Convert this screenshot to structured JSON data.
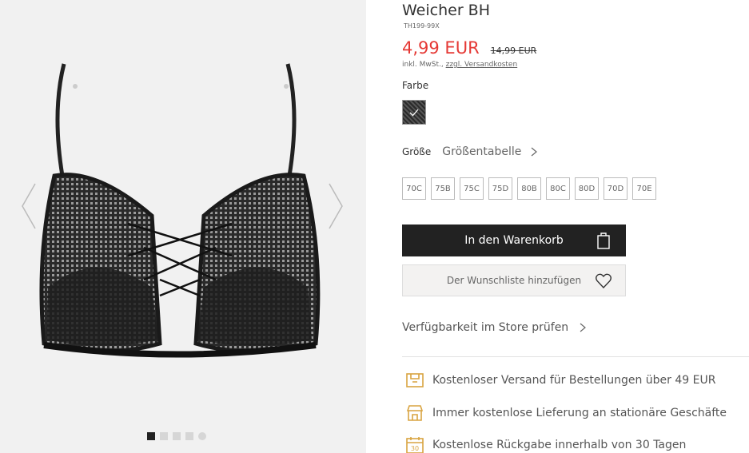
{
  "product": {
    "title": "Weicher BH",
    "sku": "TH199-99X",
    "price": "4,99 EUR",
    "old_price": "14,99 EUR",
    "tax_prefix": "inkl. MwSt.,",
    "tax_link": "zzgl. Versandkosten"
  },
  "colors": {
    "label": "Farbe",
    "selected": "Schwarz"
  },
  "sizes": {
    "label": "Größe",
    "table_link": "Größentabelle",
    "options": [
      "70C",
      "75B",
      "75C",
      "75D",
      "80B",
      "80C",
      "80D",
      "70D",
      "70E"
    ]
  },
  "actions": {
    "cart_label": "In den Warenkorb",
    "wishlist_label": "Der Wunschliste hinzufügen",
    "store_check": "Verfügbarkeit im Store prüfen"
  },
  "benefits": [
    {
      "icon": "shipping-box-icon",
      "text": "Kostenloser Versand für Bestellungen über 49 EUR"
    },
    {
      "icon": "store-icon",
      "text": "Immer kostenlose Lieferung an stationäre Geschäfte"
    },
    {
      "icon": "calendar-30-icon",
      "text": "Kostenlose Rückgabe innerhalb von 30 Tagen"
    }
  ],
  "gallery": {
    "image_count": 5,
    "active_index": 0
  },
  "colors_hex": {
    "price": "#e53935",
    "cart_bg": "#222222",
    "benefit_icon": "#d9a441"
  }
}
